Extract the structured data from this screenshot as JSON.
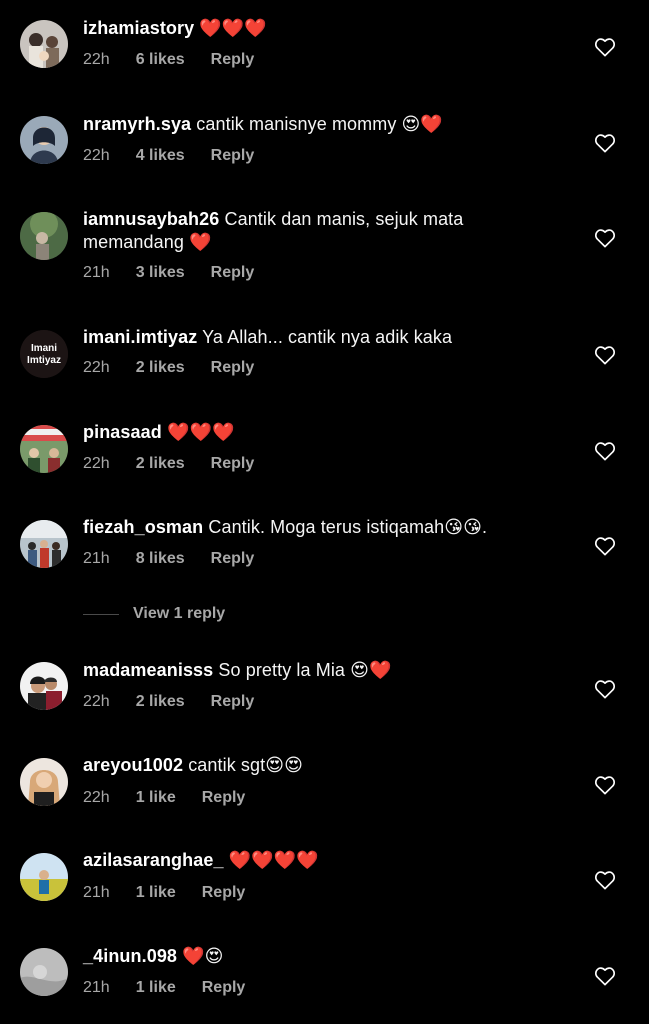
{
  "ui": {
    "background_color": "#000000",
    "text_color": "#ffffff",
    "meta_color": "#a8a8a8",
    "heart_emoji_color": "#e0263c",
    "like_icon": "heart-outline-icon"
  },
  "comments": [
    {
      "username": "izhamiastory",
      "text": "",
      "emojis": "❤️❤️❤️",
      "time": "22h",
      "likes": "6 likes",
      "reply": "Reply"
    },
    {
      "username": "nramyrh.sya",
      "text": "cantik manisnye mommy",
      "emojis": "😍❤️",
      "time": "22h",
      "likes": "4 likes",
      "reply": "Reply"
    },
    {
      "username": "iamnusaybah26",
      "text": "Cantik dan manis, sejuk mata memandang",
      "emojis": "❤️",
      "time": "21h",
      "likes": "3 likes",
      "reply": "Reply"
    },
    {
      "username": "imani.imtiyaz",
      "text": "Ya Allah... cantik nya adik kaka",
      "emojis": "",
      "time": "22h",
      "likes": "2 likes",
      "reply": "Reply",
      "avatar_text": "Imani Imtiyaz"
    },
    {
      "username": "pinasaad",
      "text": "",
      "emojis": "❤️❤️❤️",
      "time": "22h",
      "likes": "2 likes",
      "reply": "Reply"
    },
    {
      "username": "fiezah_osman",
      "text": "Cantik. Moga terus istiqamah",
      "emojis": "😘😘.",
      "time": "21h",
      "likes": "8 likes",
      "reply": "Reply"
    },
    {
      "username": "madameanisss",
      "text": "So pretty la Mia",
      "emojis": "😍❤️",
      "time": "22h",
      "likes": "2 likes",
      "reply": "Reply"
    },
    {
      "username": "areyou1002",
      "text": "cantik sgt",
      "emojis": "😍😍",
      "time": "22h",
      "likes": "1 like",
      "reply": "Reply"
    },
    {
      "username": "azilasaranghae_",
      "text": "",
      "emojis": "❤️❤️❤️❤️",
      "time": "21h",
      "likes": "1 like",
      "reply": "Reply"
    },
    {
      "username": "_4inun.098",
      "text": "",
      "emojis": "❤️😍",
      "time": "21h",
      "likes": "1 like",
      "reply": "Reply"
    }
  ],
  "view_replies": {
    "label": "View 1 reply"
  }
}
